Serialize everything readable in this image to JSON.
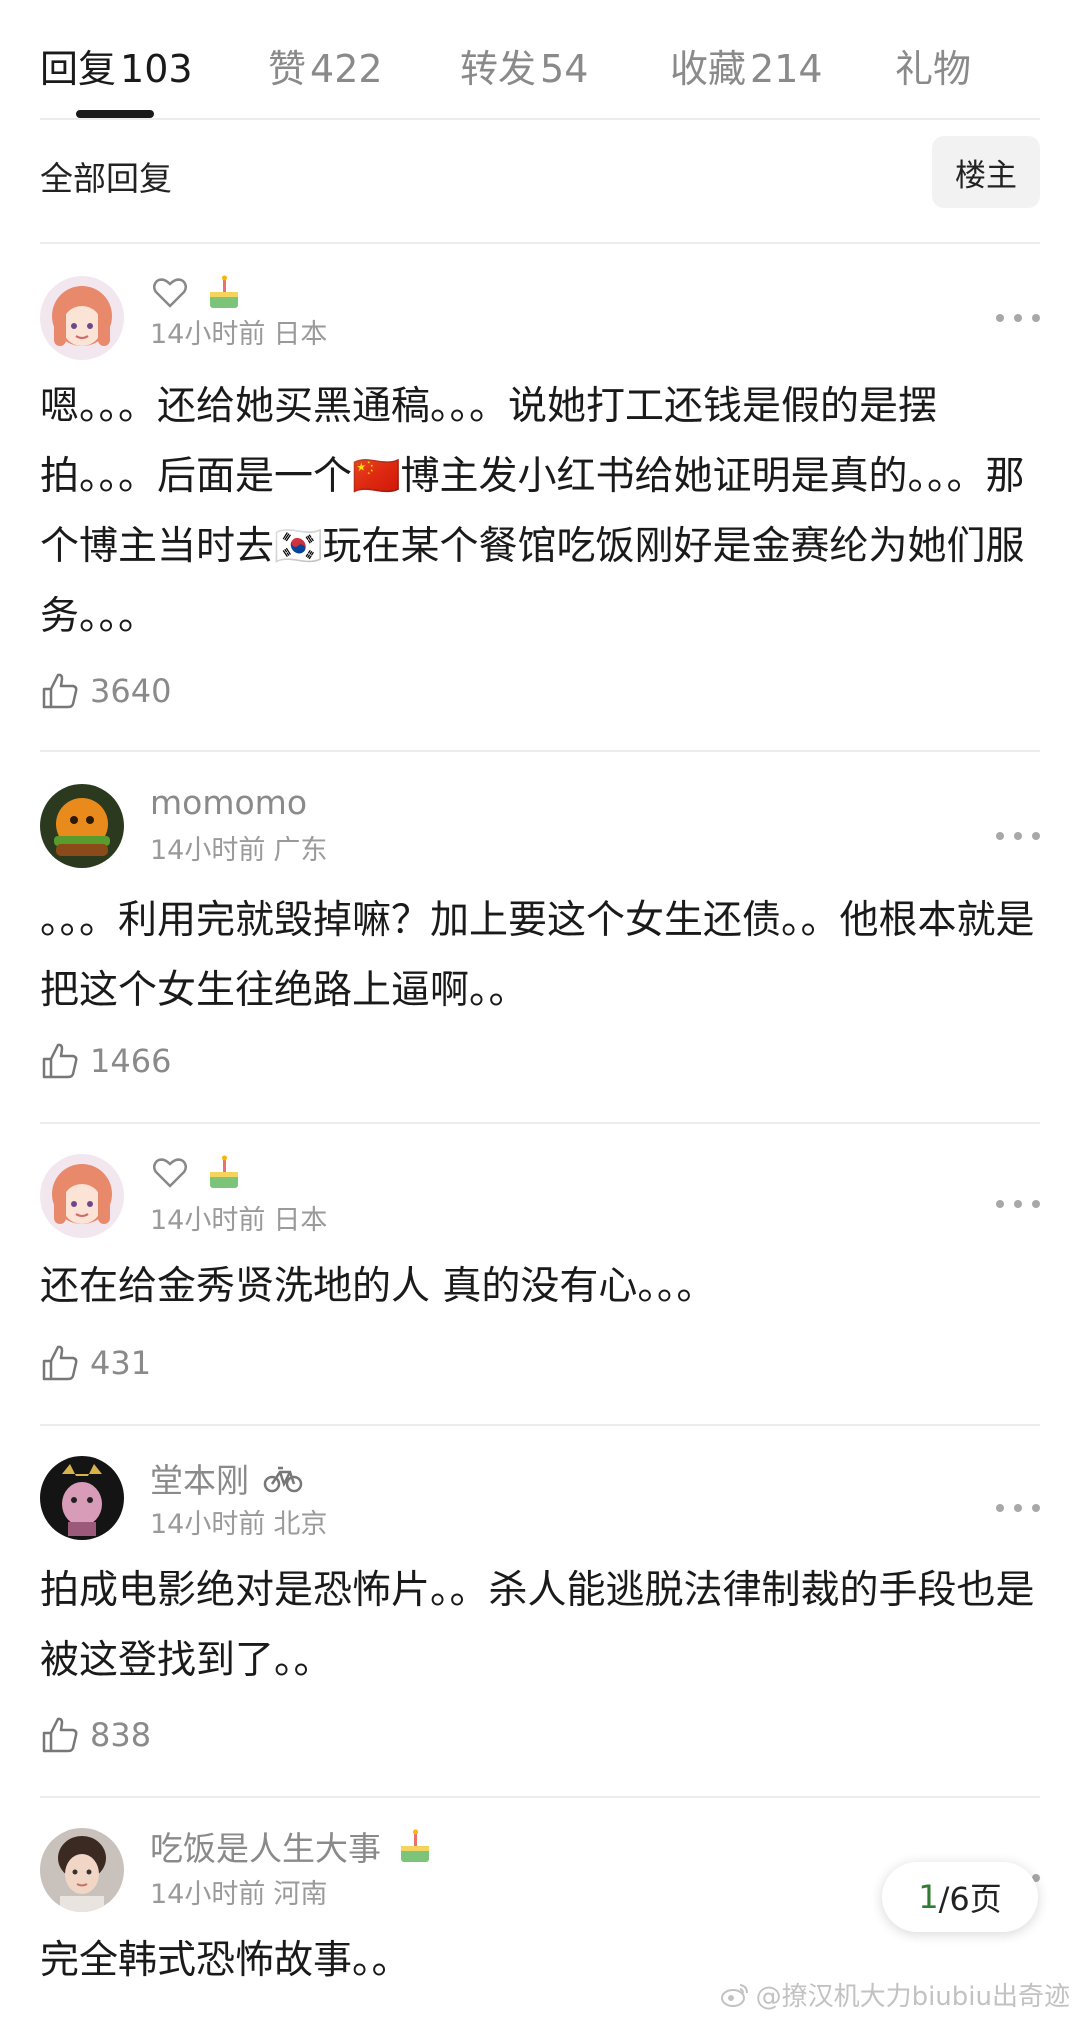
{
  "tabs": [
    {
      "label": "回复",
      "count": "103"
    },
    {
      "label": "赞",
      "count": "422"
    },
    {
      "label": "转发",
      "count": "54"
    },
    {
      "label": "收藏",
      "count": "214"
    },
    {
      "label": "礼物",
      "count": ""
    }
  ],
  "subbar": {
    "title": "全部回复",
    "owner_button": "楼主"
  },
  "comments": [
    {
      "username": "",
      "time": "14小时前",
      "location": "日本",
      "text": "嗯。。。还给她买黑通稿。。。说她打工还钱是假的是摆拍。。。后面是一个🇨🇳博主发小红书给她证明是真的。。。那个博主当时去🇰🇷玩在某个餐馆吃饭刚好是金赛纶为她们服务。。。",
      "likes": "3640"
    },
    {
      "username": "momomo",
      "time": "14小时前",
      "location": "广东",
      "text": "。。。利用完就毁掉嘛？加上要这个女生还债。。他根本就是把这个女生往绝路上逼啊。。",
      "likes": "1466"
    },
    {
      "username": "",
      "time": "14小时前",
      "location": "日本",
      "text": "还在给金秀贤洗地的人 真的没有心。。。",
      "likes": "431"
    },
    {
      "username": "堂本刚",
      "time": "14小时前",
      "location": "北京",
      "text": "拍成电影绝对是恐怖片。。杀人能逃脱法律制裁的手段也是被这登找到了。。",
      "likes": "838"
    },
    {
      "username": "吃饭是人生大事",
      "time": "14小时前",
      "location": "河南",
      "text": "完全韩式恐怖故事。。",
      "likes": ""
    }
  ],
  "pagination": {
    "current": "1",
    "total_text": "/6页"
  },
  "watermark": "@撩汉机大力biubiu出奇迹",
  "colors": {
    "accent_green": "#2e7d32",
    "muted_text": "#8a8a8a"
  }
}
